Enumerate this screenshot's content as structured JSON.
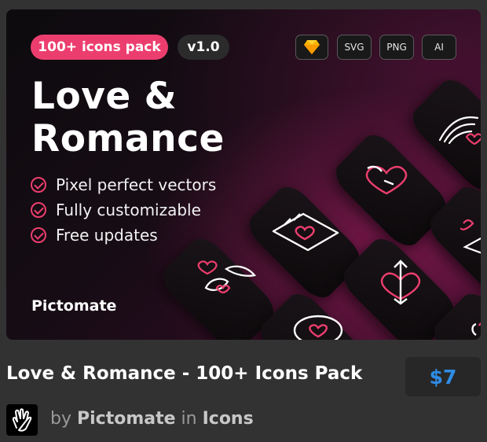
{
  "banner": {
    "pack_badge": "100+ icons pack",
    "version_badge": "v1.0",
    "formats": [
      {
        "icon": "sketch-diamond-icon",
        "label": ""
      },
      {
        "icon": "",
        "label": "SVG"
      },
      {
        "icon": "",
        "label": "PNG"
      },
      {
        "icon": "",
        "label": "AI"
      }
    ],
    "title_line1": "Love &",
    "title_line2": "Romance",
    "features": [
      "Pixel perfect vectors",
      "Fully customizable",
      "Free updates"
    ],
    "brand": "Pictomate",
    "tile_icons": [
      "wifi-heart-icon",
      "heart-lock-icon",
      "love-letter-icon",
      "hearts-feathers-icon",
      "heart-arrow-icon",
      "heart-icon",
      "heart-partial-icon",
      "send-icon"
    ],
    "colors": {
      "accent": "#ec3e6e",
      "background": "#0d0b0e",
      "glow": "#b02068"
    }
  },
  "product": {
    "title": "Love & Romance - 100+ Icons Pack",
    "price": "$7",
    "by": "by",
    "author": "Pictomate",
    "in": "in",
    "category": "Icons",
    "price_color": "#2e8de7"
  }
}
